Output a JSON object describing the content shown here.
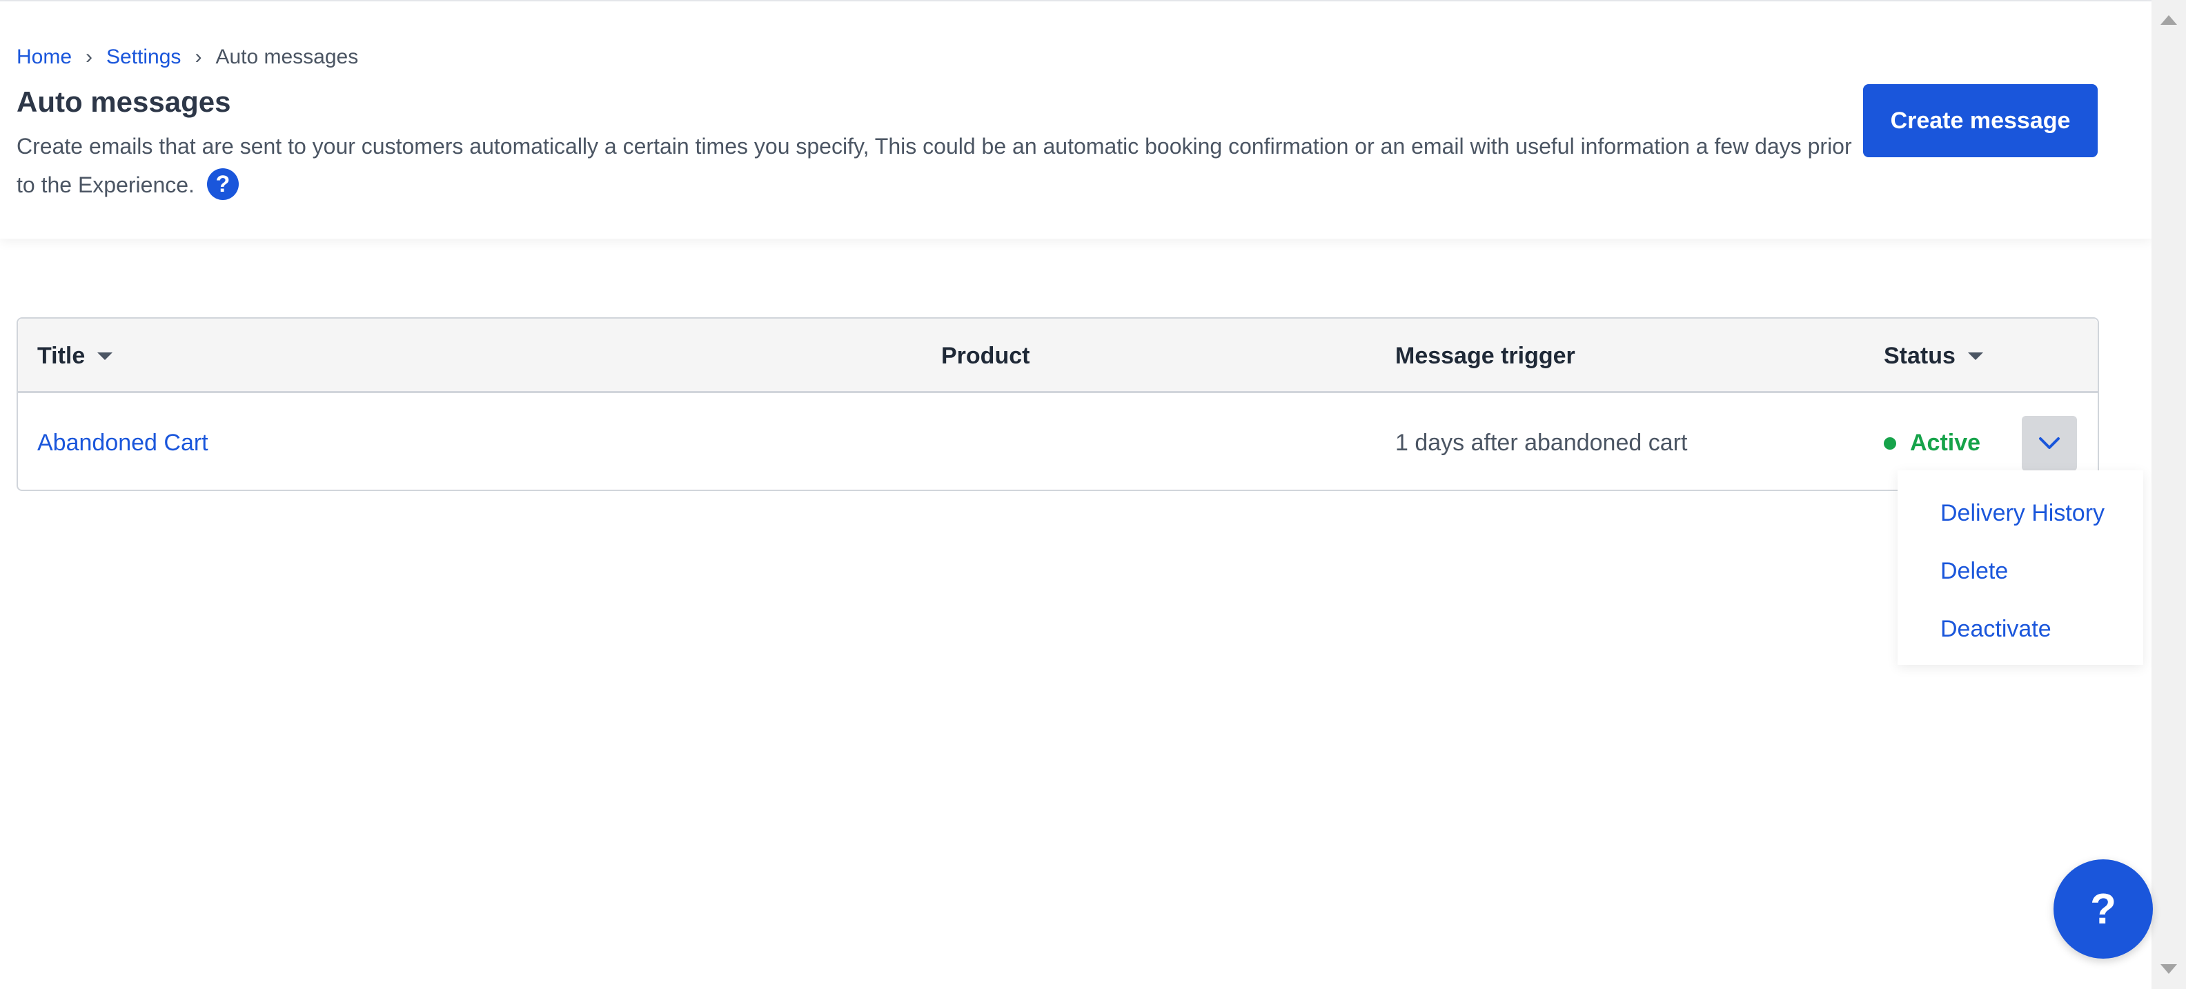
{
  "breadcrumb": {
    "items": [
      {
        "label": "Home",
        "icon": "chevron-right-icon"
      },
      {
        "label": "Settings",
        "icon": "chevron-right-icon"
      },
      {
        "label": "Auto messages"
      }
    ],
    "separator": "›"
  },
  "header": {
    "title": "Auto messages",
    "description": "Create emails that are sent to your customers automatically a certain times you specify, This could be an automatic booking confirmation or an email with useful information a few days prior to the Experience.",
    "help_icon": "?",
    "create_button_label": "Create message"
  },
  "table": {
    "columns": [
      "Title",
      "Product",
      "Message trigger",
      "Status"
    ],
    "sortable_columns": [
      "Title",
      "Status"
    ],
    "rows": [
      {
        "title": "Abandoned Cart",
        "product": "",
        "trigger": "1 days after abandoned cart",
        "status": "Active",
        "status_color": "#16a34a"
      }
    ]
  },
  "row_menu": {
    "items": [
      "Delivery History",
      "Delete",
      "Deactivate"
    ]
  },
  "help_fab": {
    "label": "?"
  },
  "colors": {
    "accent": "#1a56db",
    "active": "#16a34a",
    "text": "#1f2937",
    "muted": "#4b5563"
  },
  "icons": {
    "sort": "caret-down-icon",
    "row_toggle": "chevron-down-icon",
    "help": "question-circle-icon"
  }
}
